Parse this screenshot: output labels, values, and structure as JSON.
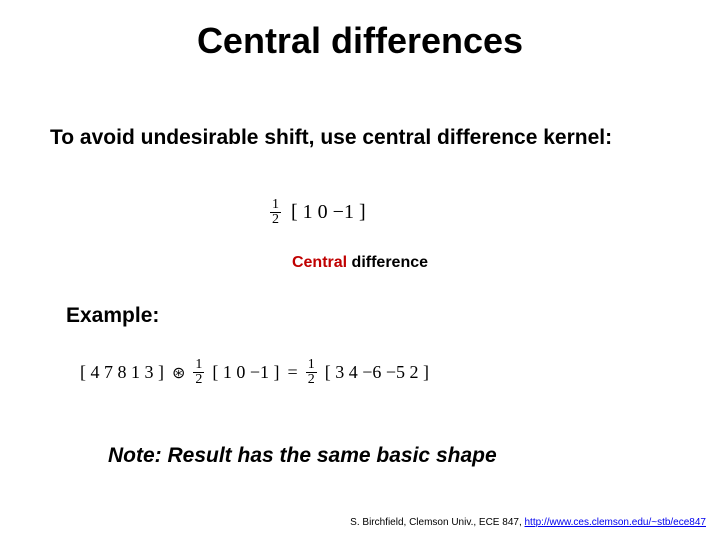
{
  "title": "Central differences",
  "lead": "To avoid undesirable shift, use central difference kernel:",
  "kernel": {
    "frac_num": "1",
    "frac_den": "2",
    "vector": "[ 1   0   −1 ]"
  },
  "caption_red": "Central",
  "caption_rest": " difference",
  "example_label": "Example:",
  "example": {
    "signal": "[ 4   7   8   1   3 ]",
    "op": "⊛",
    "frac_num": "1",
    "frac_den": "2",
    "kernel": "[ 1   0   −1 ]",
    "eq": "=",
    "rfrac_num": "1",
    "rfrac_den": "2",
    "result": "[ 3   4   −6   −5   2 ]"
  },
  "note": "Note:  Result has the same basic shape",
  "footer_text": "S. Birchfield, Clemson Univ., ECE 847, ",
  "footer_link": "http://www.ces.clemson.edu/~stb/ece847"
}
